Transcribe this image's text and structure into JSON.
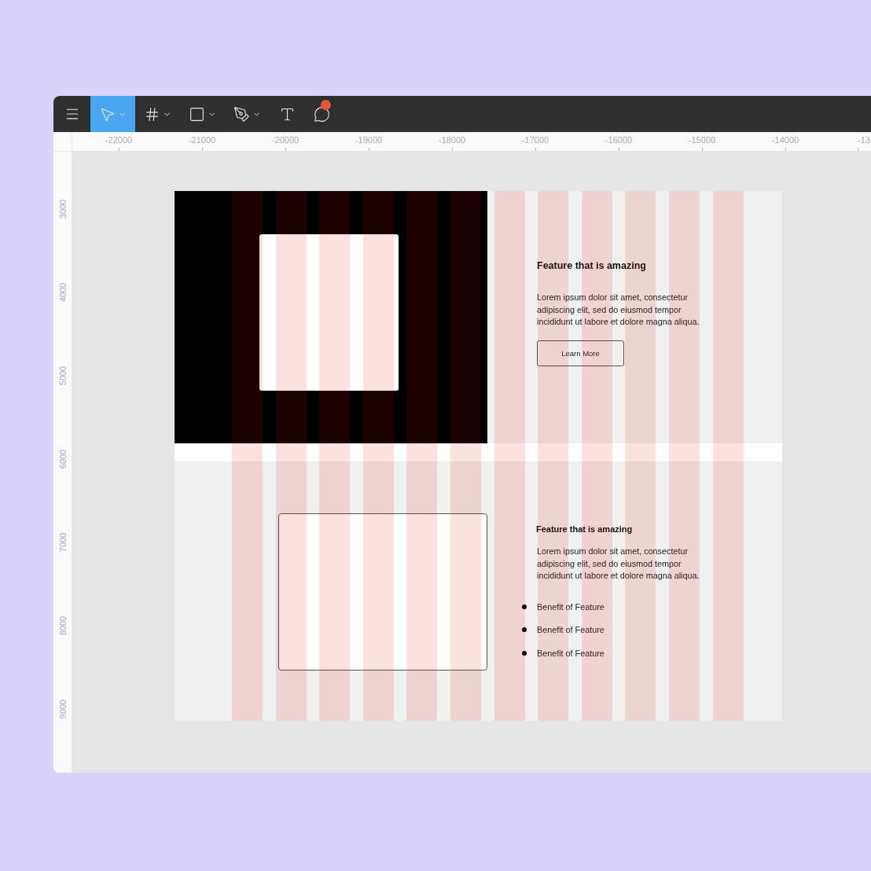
{
  "toolbar": {
    "tools": [
      {
        "kind": "menu",
        "selected": false,
        "dropdown": false,
        "notification": false
      },
      {
        "kind": "move",
        "selected": true,
        "dropdown": true,
        "notification": false
      },
      {
        "kind": "frame",
        "selected": false,
        "dropdown": true,
        "notification": false
      },
      {
        "kind": "rectangle",
        "selected": false,
        "dropdown": true,
        "notification": false
      },
      {
        "kind": "pen",
        "selected": false,
        "dropdown": true,
        "notification": false
      },
      {
        "kind": "text",
        "selected": false,
        "dropdown": false,
        "notification": false
      },
      {
        "kind": "comment",
        "selected": false,
        "dropdown": false,
        "notification": true
      }
    ]
  },
  "rulers": {
    "horizontal": [
      "-22000",
      "-21000",
      "-20000",
      "-19000",
      "-18000",
      "-17000",
      "-16000",
      "-15000",
      "-14000",
      "-13"
    ],
    "vertical": [
      "3000",
      "4000",
      "5000",
      "6000",
      "7000",
      "8000",
      "9000"
    ]
  },
  "frame": {
    "sections": [
      {
        "kind": "hero",
        "heading": "Feature that is amazing",
        "body": "Lorem ipsum dolor sit amet, consectetur adipiscing elit, sed do eiusmod tempor incididunt ut labore et dolore magna aliqua.",
        "button": "Learn More"
      },
      {
        "kind": "feature_list",
        "heading": "Feature that is amazing",
        "body": "Lorem ipsum dolor sit amet, consectetur adipiscing elit, sed do eiusmod tempor incididunt ut labore et dolore magna aliqua.",
        "bullets": [
          "Benefit of Feature",
          "Benefit of Feature",
          "Benefit of Feature"
        ]
      }
    ]
  }
}
